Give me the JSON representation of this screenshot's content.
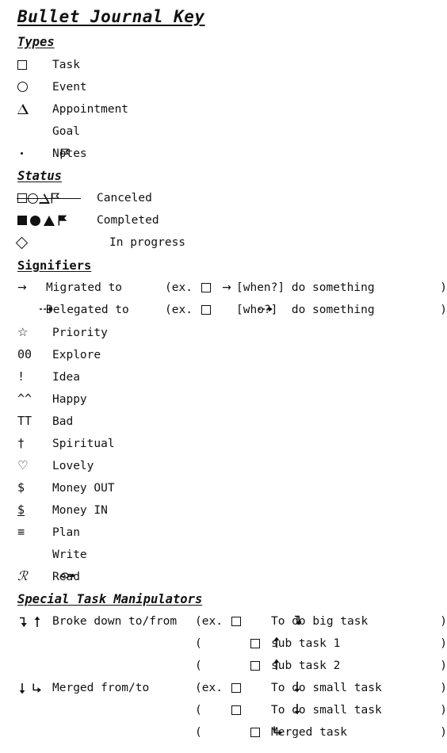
{
  "title": "Bullet Journal Key",
  "sections": {
    "types": {
      "heading": "Types",
      "items": [
        {
          "icon": "square-outline-icon",
          "label": "Task"
        },
        {
          "icon": "circle-outline-icon",
          "label": "Event"
        },
        {
          "icon": "triangle-outline-icon",
          "label": "Appointment"
        },
        {
          "icon": "flag-outline-icon",
          "label": "Goal"
        },
        {
          "icon": "dot-icon",
          "label": "Notes"
        }
      ]
    },
    "status": {
      "heading": "Status",
      "items": [
        {
          "icon": "struck-through-shapes-icon",
          "label": "Canceled"
        },
        {
          "icon": "filled-shapes-icon",
          "label": "Completed"
        },
        {
          "icon": "diamond-outline-icon",
          "label": "In progress"
        }
      ]
    },
    "signifiers": {
      "heading": "Signifiers",
      "items": [
        {
          "symbol": "→",
          "icon": "arrow-right-icon",
          "label": "Migrated to",
          "example": {
            "open": "(ex.",
            "box": "□",
            "arrow": "→",
            "text": "[when?] do something",
            "close": ")"
          }
        },
        {
          "symbol": "⇢",
          "icon": "dashed-arrow-right-icon",
          "label": "Delegated to",
          "example": {
            "open": "(ex.",
            "box": "□",
            "arrow": "⇢",
            "text": "[who?]  do something",
            "close": ")"
          }
        },
        {
          "symbol": "☆",
          "icon": "star-outline-icon",
          "label": "Priority"
        },
        {
          "symbol": "00",
          "icon": "double-zero-icon",
          "label": "Explore"
        },
        {
          "symbol": "!",
          "icon": "exclamation-icon",
          "label": "Idea"
        },
        {
          "symbol": "^^",
          "icon": "caret-caret-icon",
          "label": "Happy"
        },
        {
          "symbol": "TT",
          "icon": "tt-icon",
          "label": "Bad"
        },
        {
          "symbol": "†",
          "icon": "dagger-cross-icon",
          "label": "Spiritual"
        },
        {
          "symbol": "♡",
          "icon": "heart-outline-icon",
          "label": "Lovely"
        },
        {
          "symbol": "$",
          "icon": "dollar-icon",
          "label": "Money OUT"
        },
        {
          "symbol": "$",
          "icon": "dollar-underlined-icon",
          "label": "Money IN"
        },
        {
          "symbol": "≡",
          "icon": "triple-bar-icon",
          "label": "Plan"
        },
        {
          "symbol": "✎",
          "icon": "pen-icon",
          "label": "Write"
        },
        {
          "symbol": "ℛ",
          "icon": "script-r-icon",
          "label": "Read"
        }
      ]
    },
    "special": {
      "heading": "Special Task Manipulators",
      "items": [
        {
          "symbols": "⤵ ↑",
          "icon": "break-down-arrows-icon",
          "label": "Broke down to/from",
          "examples": [
            {
              "open": "(ex.",
              "box": "□",
              "arrow": "⤵",
              "arrow_side": "after",
              "text": "To do big task",
              "close": ")"
            },
            {
              "open": "(",
              "box": "□",
              "arrow": "↑",
              "arrow_side": "before",
              "text": "sub task 1",
              "close": ")"
            },
            {
              "open": "(",
              "box": "□",
              "arrow": "↑",
              "arrow_side": "before",
              "text": "sub task 2",
              "close": ")"
            }
          ]
        },
        {
          "symbols": "↓ ↳",
          "icon": "merge-arrows-icon",
          "label": "Merged from/to",
          "examples": [
            {
              "open": "(ex.",
              "box": "□",
              "arrow": "↓",
              "arrow_side": "after",
              "text": "To do small task",
              "close": ")"
            },
            {
              "open": "(",
              "box": "□",
              "arrow": "↓",
              "arrow_side": "after",
              "text": "To do small task",
              "close": ")"
            },
            {
              "open": "(",
              "box": "□",
              "arrow": "↳",
              "arrow_side": "before",
              "text": "Merged task",
              "close": ")"
            }
          ]
        }
      ]
    }
  },
  "colors": {
    "ink": "#111111",
    "paper": "#ffffff"
  }
}
